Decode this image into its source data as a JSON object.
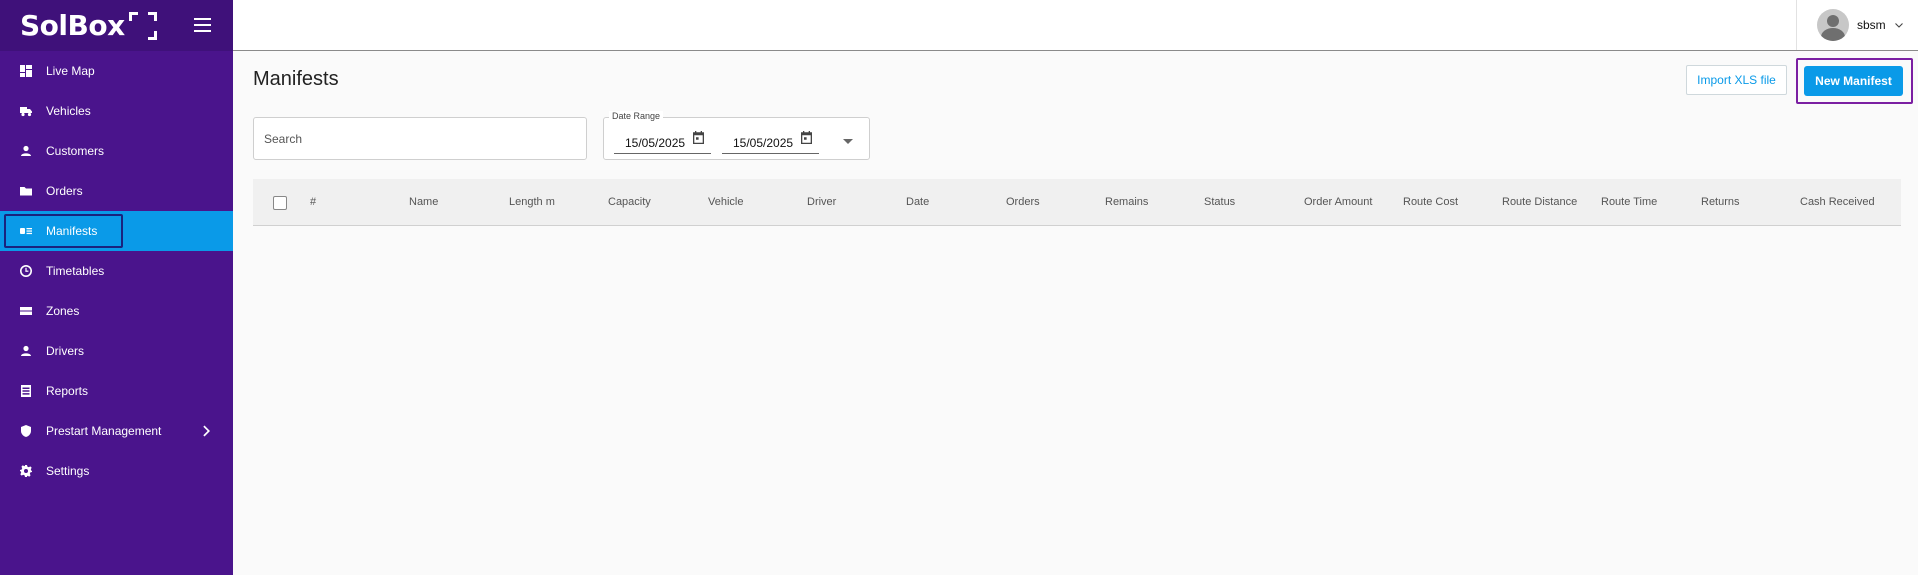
{
  "brand": {
    "name": "SolBox"
  },
  "sidebar": {
    "items": [
      {
        "label": "Live Map"
      },
      {
        "label": "Vehicles"
      },
      {
        "label": "Customers"
      },
      {
        "label": "Orders"
      },
      {
        "label": "Manifests"
      },
      {
        "label": "Timetables"
      },
      {
        "label": "Zones"
      },
      {
        "label": "Drivers"
      },
      {
        "label": "Reports"
      },
      {
        "label": "Prestart Management"
      },
      {
        "label": "Settings"
      }
    ],
    "active_index": 4
  },
  "topbar": {
    "username": "sbsm"
  },
  "page": {
    "title": "Manifests",
    "import_label": "Import XLS file",
    "new_label": "New Manifest"
  },
  "filters": {
    "search_placeholder": "Search",
    "date_range_label": "Date Range",
    "date_from": "15/05/2025",
    "date_to": "15/05/2025"
  },
  "table": {
    "columns": [
      "#",
      "Name",
      "Length m",
      "Capacity",
      "Vehicle",
      "Driver",
      "Date",
      "Orders",
      "Remains",
      "Status",
      "Order Amount",
      "Route Cost",
      "Route Distance",
      "Route Time",
      "Returns",
      "Cash Received"
    ]
  },
  "colors": {
    "sidebar": "#4a148c",
    "active": "#0a9ae8",
    "accent": "#0a9ae8",
    "highlight": "#7b1fa2"
  }
}
